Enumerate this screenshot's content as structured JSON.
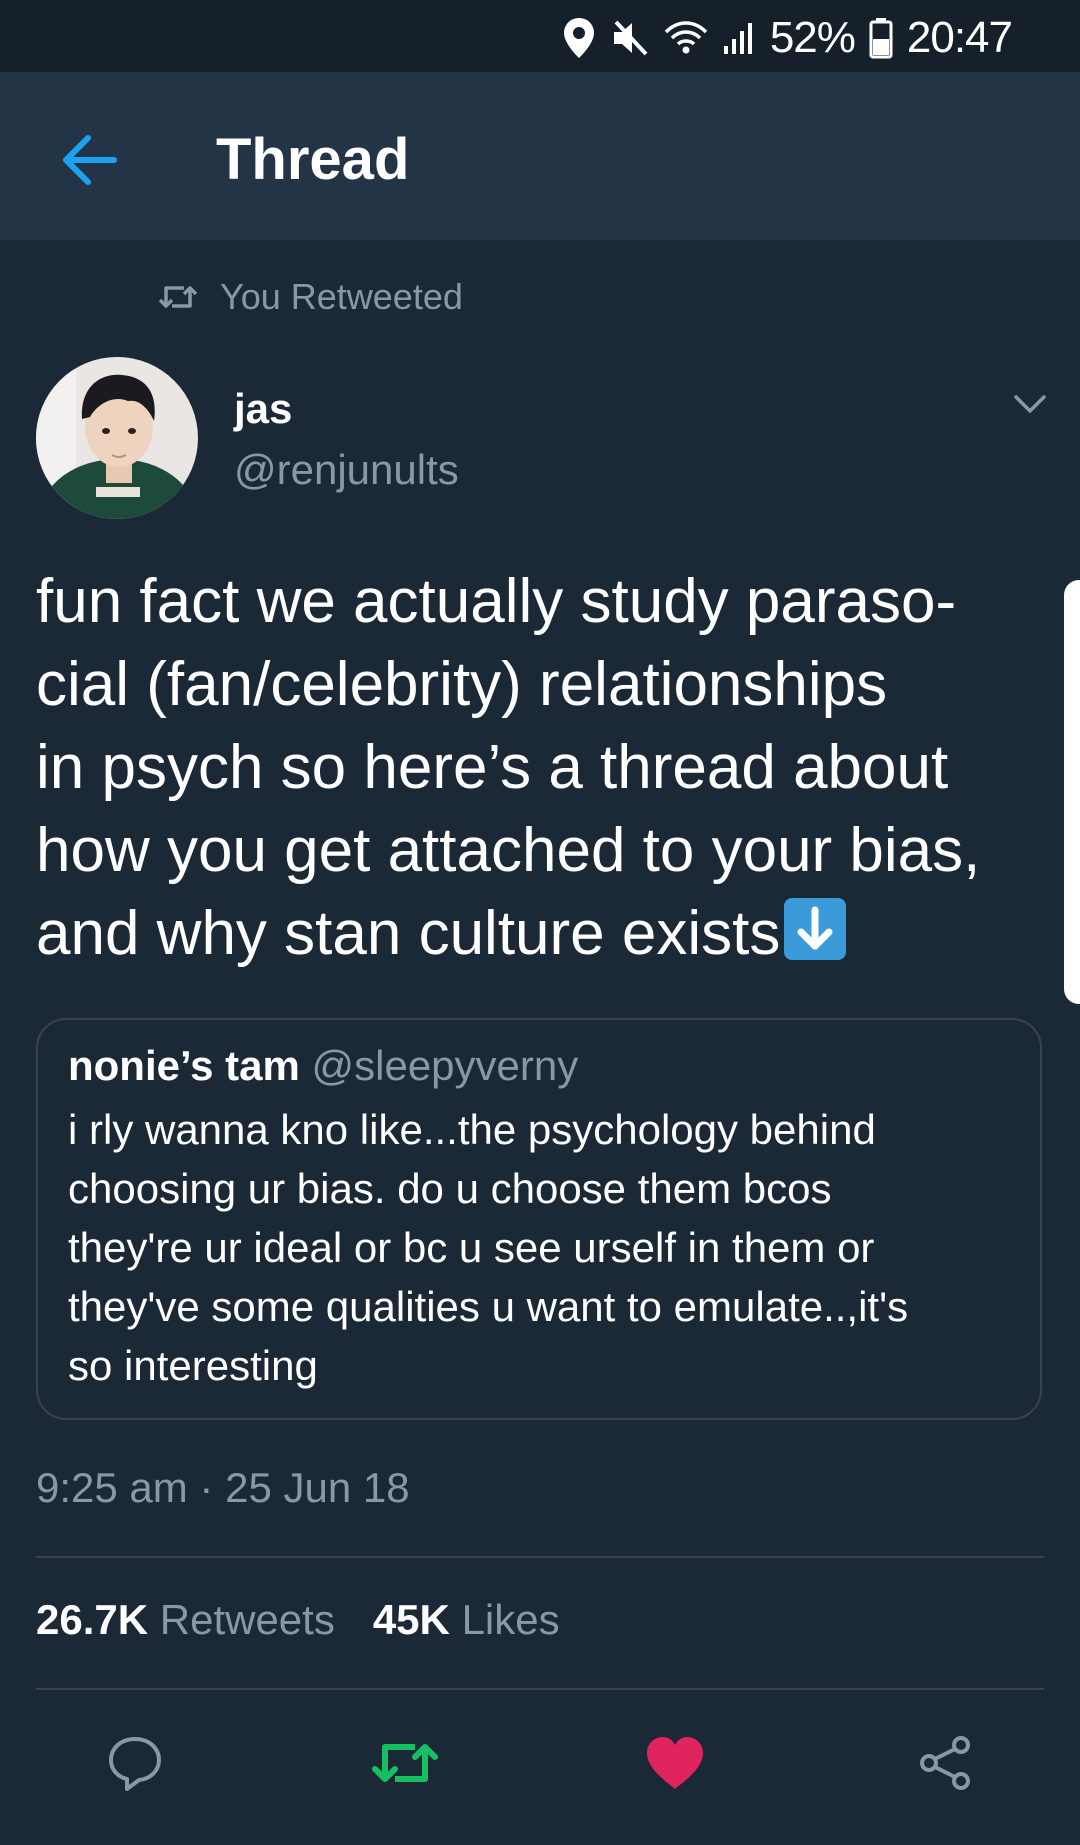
{
  "status_bar": {
    "battery": "52%",
    "time": "20:47",
    "icons": [
      "location-icon",
      "mute-icon",
      "wifi-icon",
      "signal-icon",
      "battery-icon"
    ]
  },
  "header": {
    "title": "Thread",
    "back_icon": "back-arrow-icon"
  },
  "retweet_indicator": {
    "label": "You Retweeted"
  },
  "author": {
    "name": "jas",
    "handle": "@renjunults"
  },
  "tweet": {
    "lines": [
      "fun fact we actually study paraso-",
      "cial (fan/celebrity) relationships",
      "in psych so here’s a thread about",
      "how you get attached to your bias,",
      "and why stan culture exists"
    ],
    "emoji": "down-arrow-emoji"
  },
  "quoted_tweet": {
    "name": "nonie’s tam",
    "handle": "@sleepyverny",
    "lines": [
      "i rly wanna kno like...the psychology behind",
      "choosing ur bias. do u choose them bcos",
      "they're ur ideal or bc u see urself in them or",
      "they've some qualities u want to emulate..,it's",
      "so interesting"
    ]
  },
  "timestamp": "9:25 am · 25 Jun 18",
  "stats": {
    "retweets_count": "26.7K",
    "retweets_label": "Retweets",
    "likes_count": "45K",
    "likes_label": "Likes"
  },
  "actions": {
    "reply": "reply-icon",
    "retweet": "retweet-icon",
    "like": "heart-icon",
    "share": "share-icon"
  },
  "colors": {
    "background": "#1b2836",
    "header": "#243447",
    "status_bar": "#15202b",
    "accent_blue": "#1da1f2",
    "retweet_green": "#17bf63",
    "like_red": "#e0245e",
    "secondary_text": "#8899a6",
    "border": "#38444d"
  }
}
